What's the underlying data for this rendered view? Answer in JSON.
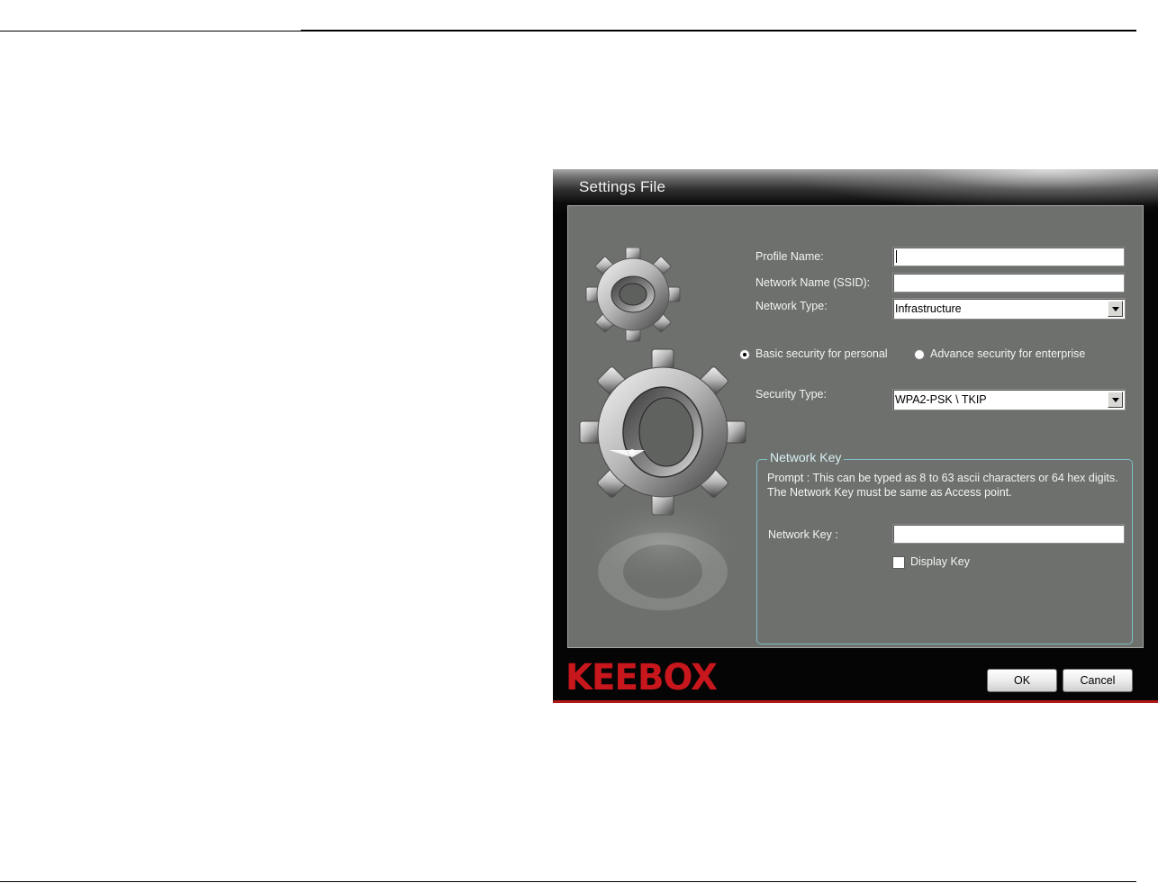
{
  "dialog": {
    "title": "Settings File",
    "fields": {
      "profile_name_label": "Profile Name:",
      "profile_name_value": "",
      "ssid_label": "Network Name (SSID):",
      "ssid_value": "",
      "network_type_label": "Network Type:",
      "network_type_value": "Infrastructure"
    },
    "security_mode": {
      "basic_label": "Basic security for personal",
      "advance_label": "Advance security for enterprise",
      "selected": "basic"
    },
    "security_type": {
      "label": "Security Type:",
      "value": "WPA2-PSK \\ TKIP"
    },
    "network_key_group": {
      "legend": "Network Key",
      "prompt": "Prompt : This can be typed as 8 to 63 ascii characters or  64 hex digits. The Network Key must be same as Access point.",
      "key_label": "Network Key :",
      "key_value": "",
      "display_key_label": "Display Key",
      "display_key_checked": false
    },
    "logo_text": "KEEBOX",
    "buttons": {
      "ok": "OK",
      "cancel": "Cancel"
    },
    "colors": {
      "panel": "#6d706c",
      "frame": "#050505",
      "logo": "#c8161d",
      "group_border": "#7fc0c8"
    }
  }
}
